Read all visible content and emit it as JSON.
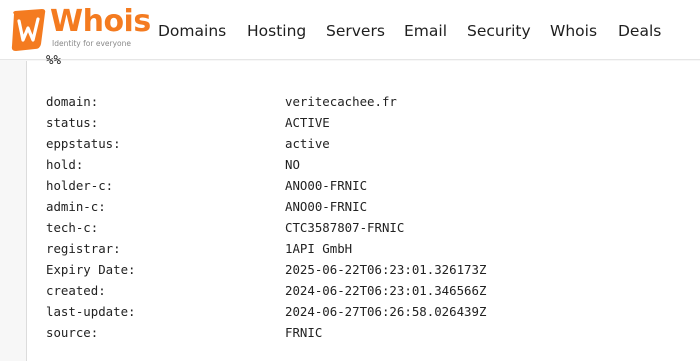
{
  "brand": {
    "name": "Whois",
    "tagline": "Identity for everyone",
    "accent_color": "#f47b20"
  },
  "nav": {
    "items": [
      "Domains",
      "Hosting",
      "Servers",
      "Email",
      "Security",
      "Whois",
      "Deals"
    ]
  },
  "whois": {
    "comment": "%%",
    "records": [
      {
        "key": "domain:",
        "value": "veritecachee.fr"
      },
      {
        "key": "status:",
        "value": "ACTIVE"
      },
      {
        "key": "eppstatus:",
        "value": "active"
      },
      {
        "key": "hold:",
        "value": "NO"
      },
      {
        "key": "holder-c:",
        "value": "ANO00-FRNIC"
      },
      {
        "key": "admin-c:",
        "value": "ANO00-FRNIC"
      },
      {
        "key": "tech-c:",
        "value": "CTC3587807-FRNIC"
      },
      {
        "key": "registrar:",
        "value": "1API GmbH"
      },
      {
        "key": "Expiry Date:",
        "value": "2025-06-22T06:23:01.326173Z"
      },
      {
        "key": "created:",
        "value": "2024-06-22T06:23:01.346566Z"
      },
      {
        "key": "last-update:",
        "value": "2024-06-27T06:26:58.026439Z"
      },
      {
        "key": "source:",
        "value": "FRNIC"
      }
    ]
  }
}
